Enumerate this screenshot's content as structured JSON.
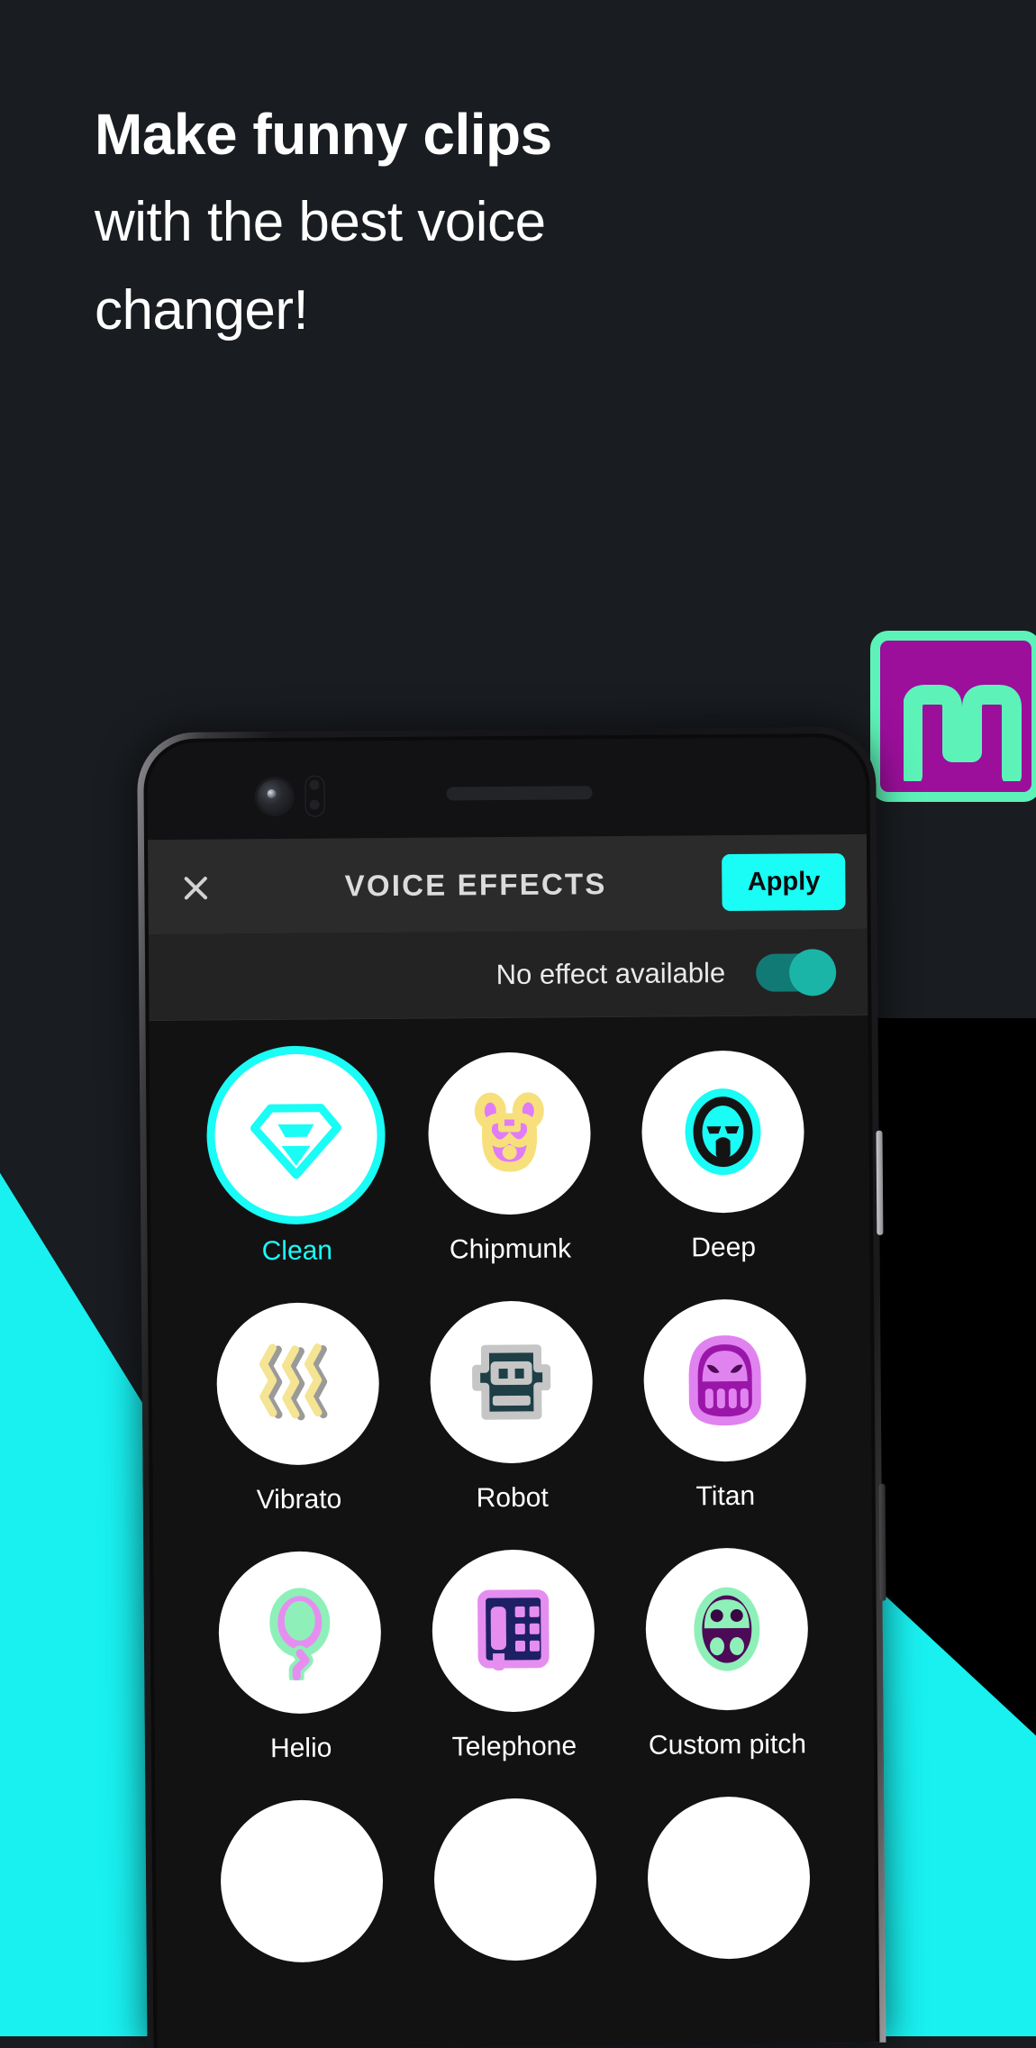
{
  "headline": {
    "line1": "Make funny clips",
    "line2": "with the best voice",
    "line3": "changer!"
  },
  "colors": {
    "background": "#191c20",
    "accent_cyan": "#19f0f0",
    "apply_cyan": "#1afcf6",
    "logo_purple": "#9b0f9b",
    "logo_mint": "#5df3b8",
    "toggle_teal": "#1bb5a7",
    "screen_bg": "#121212",
    "header_bg": "#2b2b2b"
  },
  "logo": {
    "name": "app-logo-badge",
    "glyph": "square-wave-m"
  },
  "phone": {
    "camera": {
      "lens": "front-camera-lens",
      "sensors": "proximity-sensors",
      "earpiece": "earpiece-speaker"
    },
    "side_buttons": [
      "power-button",
      "volume-button"
    ]
  },
  "app": {
    "header": {
      "close_icon": "close-icon",
      "title": "VOICE EFFECTS",
      "apply_label": "Apply"
    },
    "toggle_row": {
      "label": "No effect available",
      "state": "on"
    },
    "effects": [
      {
        "label": "Clean",
        "icon": "diamond-gem-icon",
        "selected": true
      },
      {
        "label": "Chipmunk",
        "icon": "chipmunk-face-icon",
        "selected": false
      },
      {
        "label": "Deep",
        "icon": "deep-face-icon",
        "selected": false
      },
      {
        "label": "Vibrato",
        "icon": "vibrato-waves-icon",
        "selected": false
      },
      {
        "label": "Robot",
        "icon": "robot-head-icon",
        "selected": false
      },
      {
        "label": "Titan",
        "icon": "titan-skull-icon",
        "selected": false
      },
      {
        "label": "Helio",
        "icon": "helium-balloon-icon",
        "selected": false
      },
      {
        "label": "Telephone",
        "icon": "telephone-icon",
        "selected": false
      },
      {
        "label": "Custom pitch",
        "icon": "alien-face-icon",
        "selected": false
      }
    ],
    "partial_row_visible": true
  }
}
